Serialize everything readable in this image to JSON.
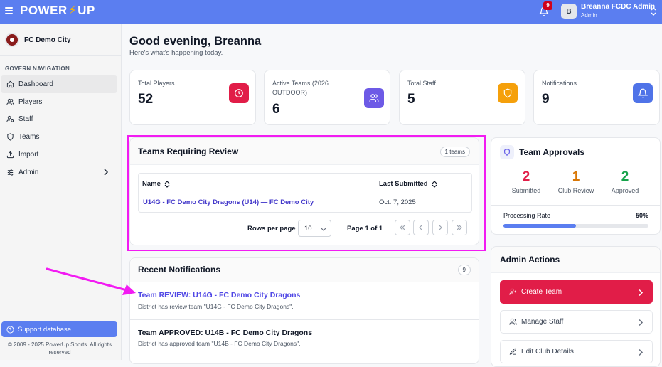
{
  "topbar": {
    "logo_left": "POWER",
    "logo_bolt": "⚡",
    "logo_right": "UP",
    "notification_count": "9",
    "user_initial": "B",
    "user_name": "Breanna FCDC Admin",
    "user_role": "Admin"
  },
  "sidebar": {
    "club_name": "FC Demo City",
    "nav_title": "GOVERN NAVIGATION",
    "items": [
      {
        "label": "Dashboard",
        "icon": "home-icon"
      },
      {
        "label": "Players",
        "icon": "users-icon"
      },
      {
        "label": "Staff",
        "icon": "user-cog-icon"
      },
      {
        "label": "Teams",
        "icon": "shield-icon"
      },
      {
        "label": "Import",
        "icon": "upload-icon"
      },
      {
        "label": "Admin",
        "icon": "sliders-icon"
      }
    ],
    "support_label": "Support database",
    "copyright": "© 2009 - 2025 PowerUp Sports. All rights reserved"
  },
  "header": {
    "greeting": "Good evening, Breanna",
    "subtitle": "Here's what's happening today."
  },
  "stats": [
    {
      "label": "Total Players",
      "value": "52",
      "color": "#e11d48"
    },
    {
      "label": "Active Teams (2026 OUTDOOR)",
      "value": "6",
      "color": "#6d5ae6"
    },
    {
      "label": "Total Staff",
      "value": "5",
      "color": "#f5a00b"
    },
    {
      "label": "Notifications",
      "value": "9",
      "color": "#4f73e8"
    }
  ],
  "review": {
    "title": "Teams Requiring Review",
    "badge": "1 teams",
    "col_name": "Name",
    "col_submitted": "Last Submitted",
    "rows": [
      {
        "name": "U14G - FC Demo City Dragons (U14) — FC Demo City",
        "date": "Oct. 7, 2025"
      }
    ],
    "rows_per_page_label": "Rows per page",
    "rows_per_page_value": "10",
    "page_label": "Page 1 of 1"
  },
  "notifications": {
    "title": "Recent Notifications",
    "count": "9",
    "items": [
      {
        "title": "Team REVIEW: U14G - FC Demo City Dragons",
        "text": "District has review team \"U14G - FC Demo City Dragons\".",
        "color": "#4f46e5"
      },
      {
        "title": "Team APPROVED: U14B - FC Demo City Dragons",
        "text": "District has approved team \"U14B - FC Demo City Dragons\".",
        "color": "#111827"
      }
    ]
  },
  "approvals": {
    "title": "Team Approvals",
    "stats": [
      {
        "value": "2",
        "label": "Submitted",
        "color": "#e11d48"
      },
      {
        "value": "1",
        "label": "Club Review",
        "color": "#d97706"
      },
      {
        "value": "2",
        "label": "Approved",
        "color": "#16a34a"
      }
    ],
    "rate_label": "Processing Rate",
    "rate_value": "50%",
    "rate_fraction": 0.5
  },
  "admin_actions": {
    "title": "Admin Actions",
    "buttons": [
      {
        "label": "Create Team",
        "icon": "user-plus-icon"
      },
      {
        "label": "Manage Staff",
        "icon": "users-icon"
      },
      {
        "label": "Edit Club Details",
        "icon": "edit-icon"
      }
    ]
  }
}
